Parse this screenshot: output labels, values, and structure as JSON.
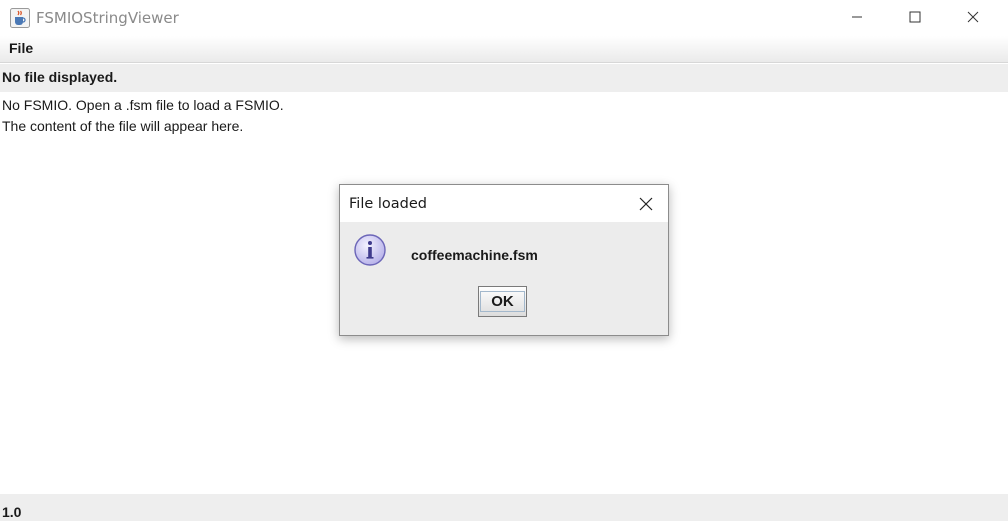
{
  "window": {
    "title": "FSMIOStringViewer",
    "icon": "java-cup-icon",
    "controls": [
      "minimize-icon",
      "maximize-icon",
      "close-icon"
    ]
  },
  "menubar": {
    "items": [
      {
        "label": "File"
      }
    ]
  },
  "file_bar": {
    "label": "No file displayed."
  },
  "content": {
    "lines": [
      "No FSMIO. Open a .fsm file to load a FSMIO.",
      "The content of the file will appear here."
    ]
  },
  "status": {
    "version": "1.0"
  },
  "dialog": {
    "title": "File loaded",
    "icon": "info-icon",
    "message": "coffeemachine.fsm",
    "ok_label": "OK"
  }
}
